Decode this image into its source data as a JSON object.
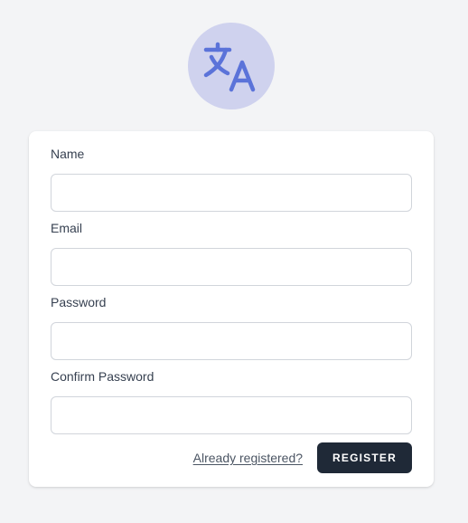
{
  "logo": {
    "icon": "translate-icon",
    "background_color": "#cfd2ee",
    "icon_color": "#5b73d9"
  },
  "form": {
    "name_label": "Name",
    "name_value": "",
    "email_label": "Email",
    "email_value": "",
    "password_label": "Password",
    "password_value": "",
    "confirm_password_label": "Confirm Password",
    "confirm_password_value": ""
  },
  "actions": {
    "login_link": "Already registered?",
    "register_button": "REGISTER"
  },
  "colors": {
    "page_background": "#f3f4f6",
    "button_background": "#1f2937"
  }
}
